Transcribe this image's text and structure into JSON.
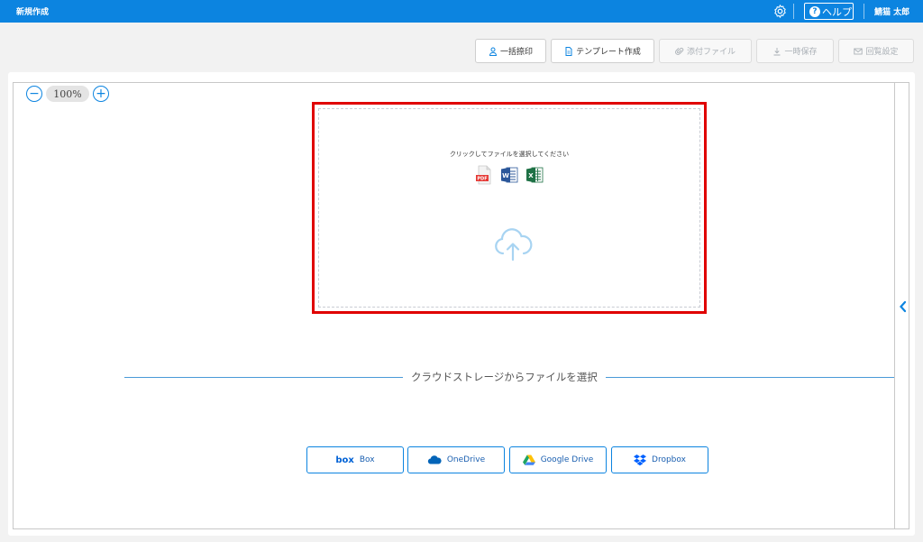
{
  "header": {
    "title": "新規作成",
    "help_label": "ヘルプ",
    "user_name": "鯖猫 太郎"
  },
  "toolbar": {
    "bulk_stamp": "一括捺印",
    "template_create": "テンプレート作成",
    "attach_file": "添付ファイル",
    "temp_save": "一時保存",
    "circulation_settings": "回覧設定"
  },
  "viewer": {
    "zoom": "100%"
  },
  "upload": {
    "prompt": "クリックしてファイルを選択してください",
    "file_types": [
      "pdf-icon",
      "word-icon",
      "excel-icon"
    ]
  },
  "cloud_storage": {
    "heading": "クラウドストレージからファイルを選択",
    "providers": [
      {
        "label": "Box",
        "color": "#0061d5"
      },
      {
        "label": "OneDrive",
        "color": "#0364b8"
      },
      {
        "label": "Google Drive",
        "color": "#1fa463"
      },
      {
        "label": "Dropbox",
        "color": "#0061ff"
      }
    ]
  },
  "colors": {
    "accent": "#0c84e0",
    "highlight": "#e00000"
  }
}
